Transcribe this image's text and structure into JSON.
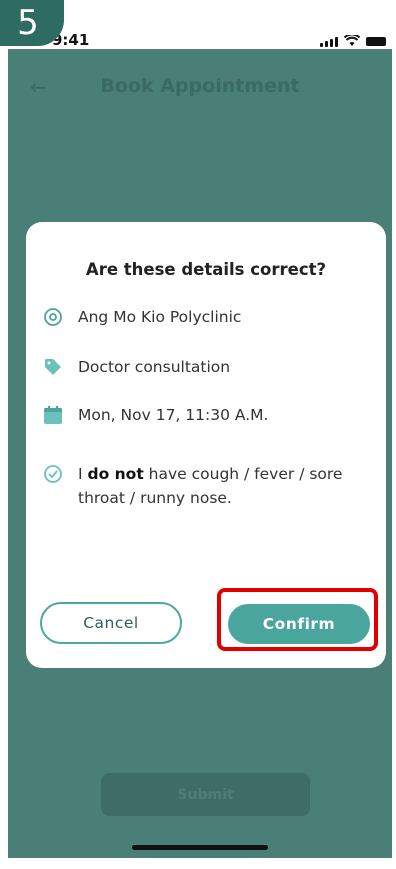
{
  "step_number": "5",
  "status_bar": {
    "time": "9:41"
  },
  "app_bar": {
    "title": "Book Appointment"
  },
  "background": {
    "submit_label": "Submit"
  },
  "dialog": {
    "title": "Are these details correct?",
    "location": "Ang Mo Kio Polyclinic",
    "service": "Doctor consultation",
    "datetime": "Mon, Nov 17, 11:30 A.M.",
    "declaration": {
      "prefix": "I ",
      "bold": "do not",
      "suffix": " have cough / fever / sore throat / runny nose."
    },
    "cancel_label": "Cancel",
    "confirm_label": "Confirm"
  },
  "colors": {
    "accent": "#4aa69d",
    "overlay": "#4a7f77",
    "highlight": "#e00000"
  },
  "icons": [
    "back-arrow-icon",
    "location-pin-icon",
    "tag-icon",
    "calendar-icon",
    "check-circle-icon",
    "signal-icon",
    "wifi-icon",
    "battery-icon"
  ]
}
